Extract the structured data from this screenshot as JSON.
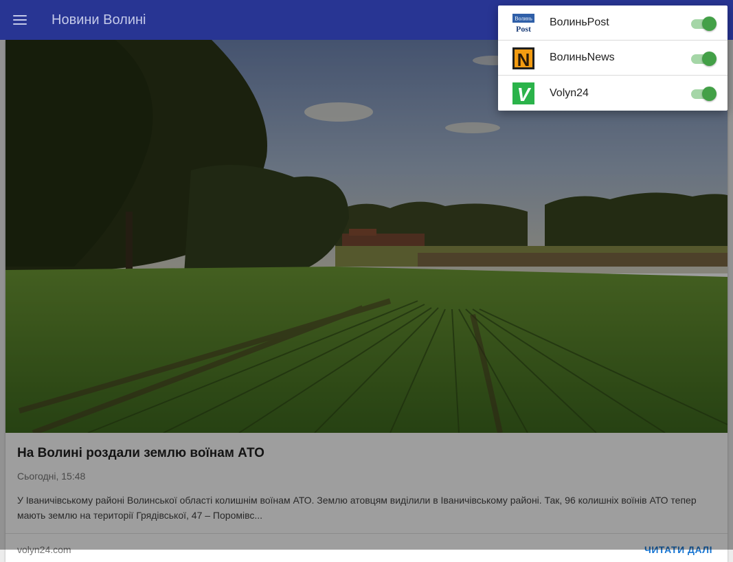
{
  "app_bar": {
    "title": "Новини Волині",
    "background": "#283593",
    "menu_icon": "hamburger-menu-icon"
  },
  "article": {
    "title": "На Волині роздали землю воїнам АТО",
    "date": "Сьогодні, 15:48",
    "excerpt": "У Іваничівському районі Волинської області колишнім воїнам АТО. Землю атовцям виділили в Іваничівському районі. Так, 96 колишніх воїнів АТО тепер мають землю на території Грядівської, 47 – Поромівс...",
    "source_label": "volyn24.com",
    "read_more_label": "ЧИТАТИ ДАЛІ",
    "image_description_icon": "field-landscape-photo"
  },
  "sources_menu": {
    "items": [
      {
        "label": "ВолиньPost",
        "logo": "volynpost-logo",
        "logo_text_top": "Волинь",
        "logo_text_bottom": "Post",
        "enabled": true
      },
      {
        "label": "ВолиньNews",
        "logo": "volynnews-logo",
        "logo_text": "N",
        "enabled": true
      },
      {
        "label": "Volyn24",
        "logo": "volyn24-logo",
        "logo_text": "V",
        "enabled": true
      }
    ],
    "toggle_on_color": "#43a047"
  }
}
